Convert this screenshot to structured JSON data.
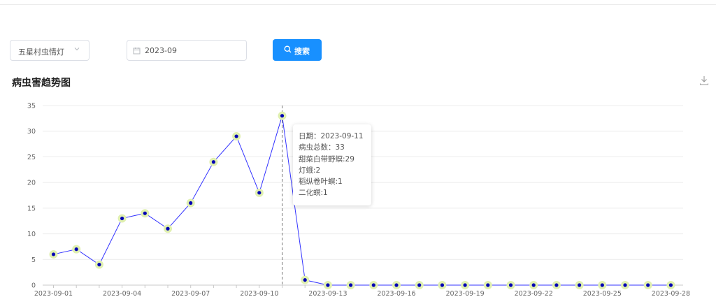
{
  "filters": {
    "location": "五星村虫情灯",
    "date": "2023-09",
    "search_label": "搜索"
  },
  "chart_title": "病虫害趋势图",
  "tooltip": {
    "lines": [
      "日期：2023-09-11",
      "病虫总数：33",
      "甜菜白带野螟:29",
      "灯蛾:2",
      "稻纵卷叶螟:1",
      "二化螟:1"
    ]
  },
  "chart_data": {
    "type": "line",
    "title": "病虫害趋势图",
    "x": [
      "2023-09-01",
      "2023-09-02",
      "2023-09-03",
      "2023-09-04",
      "2023-09-05",
      "2023-09-06",
      "2023-09-07",
      "2023-09-08",
      "2023-09-09",
      "2023-09-10",
      "2023-09-11",
      "2023-09-12",
      "2023-09-13",
      "2023-09-14",
      "2023-09-15",
      "2023-09-16",
      "2023-09-17",
      "2023-09-18",
      "2023-09-19",
      "2023-09-20",
      "2023-09-21",
      "2023-09-22",
      "2023-09-23",
      "2023-09-24",
      "2023-09-25",
      "2023-09-26",
      "2023-09-27",
      "2023-09-28"
    ],
    "values": [
      6,
      7,
      4,
      13,
      14,
      11,
      16,
      24,
      29,
      18,
      33,
      1,
      0,
      0,
      0,
      0,
      0,
      0,
      0,
      0,
      0,
      0,
      0,
      0,
      0,
      0,
      0,
      0
    ],
    "x_tick_labels": [
      "2023-09-01",
      "2023-09-04",
      "2023-09-07",
      "2023-09-10",
      "2023-09-13",
      "2023-09-16",
      "2023-09-19",
      "2023-09-22",
      "2023-09-25",
      "2023-09-28"
    ],
    "y_ticks": [
      0,
      5,
      10,
      15,
      20,
      25,
      30,
      35
    ],
    "ylim": [
      0,
      35
    ],
    "grid": true,
    "line_color": "#3333ff",
    "point_color": "#0000b4",
    "halo_color": "#e0f0b0",
    "highlighted": "2023-09-11"
  }
}
